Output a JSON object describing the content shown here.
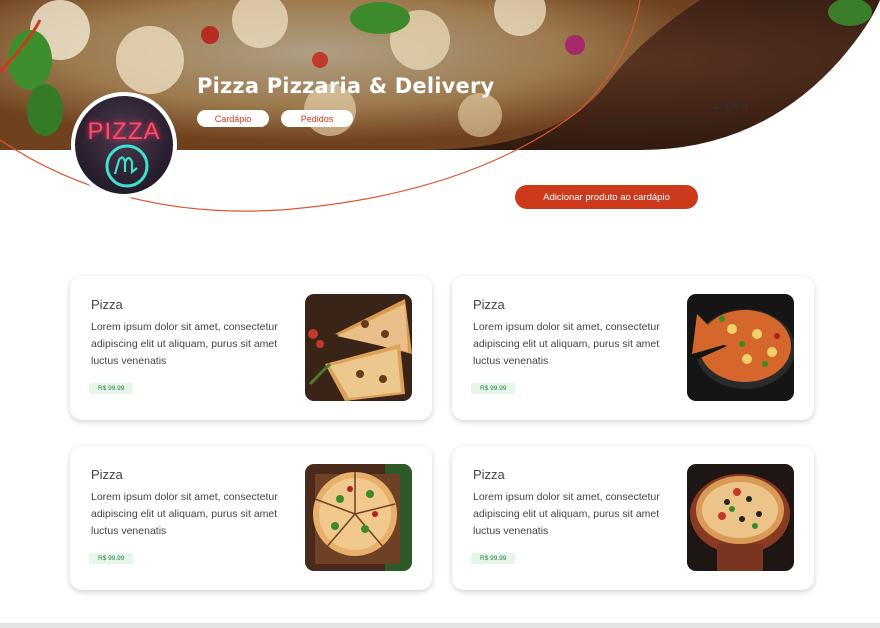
{
  "header": {
    "store_name": "Pizza Pizzaria & Delivery",
    "nav": {
      "menu_label": "Cardápio",
      "orders_label": "Pedidos"
    },
    "logout_label": "Logout",
    "logo_text": "PIZZA"
  },
  "actions": {
    "add_product_label": "Adicionar produto ao cardápio"
  },
  "products": [
    {
      "title": "Pizza",
      "description": "Lorem ipsum dolor sit amet, consectetur adipiscing elit ut aliquam, purus sit amet luctus venenatis",
      "price": "R$ 99.99"
    },
    {
      "title": "Pizza",
      "description": "Lorem ipsum dolor sit amet, consectetur adipiscing elit ut aliquam, purus sit amet luctus venenatis",
      "price": "R$ 99.99"
    },
    {
      "title": "Pizza",
      "description": "Lorem ipsum dolor sit amet, consectetur adipiscing elit ut aliquam, purus sit amet luctus venenatis",
      "price": "R$ 99.99"
    },
    {
      "title": "Pizza",
      "description": "Lorem ipsum dolor sit amet, consectetur adipiscing elit ut aliquam, purus sit amet luctus venenatis",
      "price": "R$ 99.99"
    }
  ],
  "colors": {
    "accent": "#cc3a1b",
    "price_bg": "#e6f6ea",
    "price_text": "#2b7a3c"
  }
}
